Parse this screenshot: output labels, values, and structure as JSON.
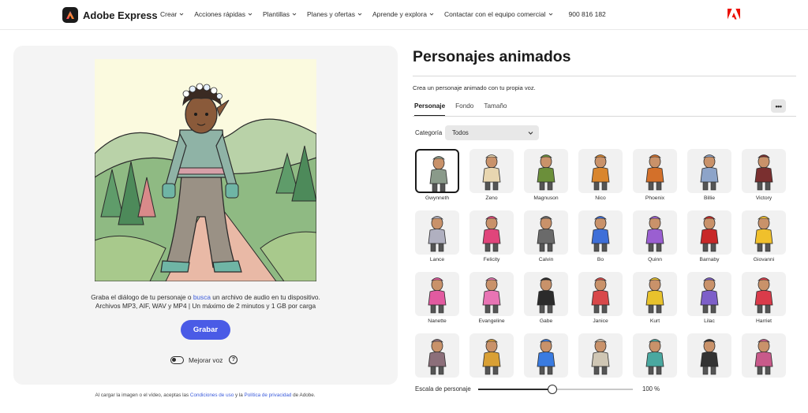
{
  "nav": {
    "brand": "Adobe Express",
    "items": [
      {
        "label": "Crear"
      },
      {
        "label": "Acciones rápidas"
      },
      {
        "label": "Plantillas"
      },
      {
        "label": "Planes y ofertas"
      },
      {
        "label": "Aprende y explora"
      },
      {
        "label": "Contactar con el equipo comercial"
      }
    ],
    "phone": "900 816 182"
  },
  "left": {
    "instruction_before": "Graba el diálogo de tu personaje o ",
    "instruction_link": "busca",
    "instruction_after": "  un archivo de audio en tu dispositivo.",
    "instruction_line2": "Archivos MP3, AIF, WAV y MP4 | Un máximo de 2 minutos y 1 GB por carga",
    "record_button": "Grabar",
    "voice_toggle_label": "Mejorar voz",
    "voice_toggle_on": false,
    "help_glyph": "?",
    "footnote_before": "Al cargar la imagen o el vídeo, aceptas las ",
    "footnote_terms": "Condiciones de uso",
    "footnote_middle": " y la ",
    "footnote_privacy": "Política de privacidad",
    "footnote_after": " de Adobe."
  },
  "right": {
    "title": "Personajes animados",
    "subtitle": "Crea un personaje animado con tu propia voz.",
    "tabs": [
      {
        "label": "Personaje",
        "active": true
      },
      {
        "label": "Fondo",
        "active": false
      },
      {
        "label": "Tamaño",
        "active": false
      }
    ],
    "more_glyph": "•••",
    "category_label": "Categoría",
    "category_value": "Todos",
    "characters": [
      {
        "name": "Gwynneth",
        "selected": true,
        "color": "#8a9a8a"
      },
      {
        "name": "Zeno",
        "color": "#e8d6b0"
      },
      {
        "name": "Magnuson",
        "color": "#6b8f3a"
      },
      {
        "name": "Nico",
        "color": "#d9862e"
      },
      {
        "name": "Phoenix",
        "color": "#d3702a"
      },
      {
        "name": "Billie",
        "color": "#8da4c9"
      },
      {
        "name": "Victory",
        "color": "#7a2f2f"
      },
      {
        "name": "Lance",
        "color": "#b0b0c0"
      },
      {
        "name": "Felicity",
        "color": "#e0457b"
      },
      {
        "name": "Calvin",
        "color": "#6a6a6a"
      },
      {
        "name": "Bo",
        "color": "#3e6fd8"
      },
      {
        "name": "Quinn",
        "color": "#9a5fd1"
      },
      {
        "name": "Barnaby",
        "color": "#c82828"
      },
      {
        "name": "Giovanni",
        "color": "#f0c02c"
      },
      {
        "name": "Nanette",
        "color": "#e25aa0"
      },
      {
        "name": "Evangeline",
        "color": "#e874b4"
      },
      {
        "name": "Gabe",
        "color": "#2b2b2b"
      },
      {
        "name": "Janice",
        "color": "#d8484a"
      },
      {
        "name": "Kurt",
        "color": "#e8c22c"
      },
      {
        "name": "Lilac",
        "color": "#7d5fc9"
      },
      {
        "name": "Harriet",
        "color": "#d93b4a"
      },
      {
        "name": "",
        "color": "#8c6f7a"
      },
      {
        "name": "",
        "color": "#d9a035"
      },
      {
        "name": "",
        "color": "#3a7be0"
      },
      {
        "name": "",
        "color": "#cfc6b4"
      },
      {
        "name": "",
        "color": "#4aa8a0"
      },
      {
        "name": "",
        "color": "#333333"
      },
      {
        "name": "",
        "color": "#c85a8a"
      }
    ],
    "scale_label": "Escala de personaje",
    "scale_value": "100 %",
    "scale_fraction": 0.48
  }
}
